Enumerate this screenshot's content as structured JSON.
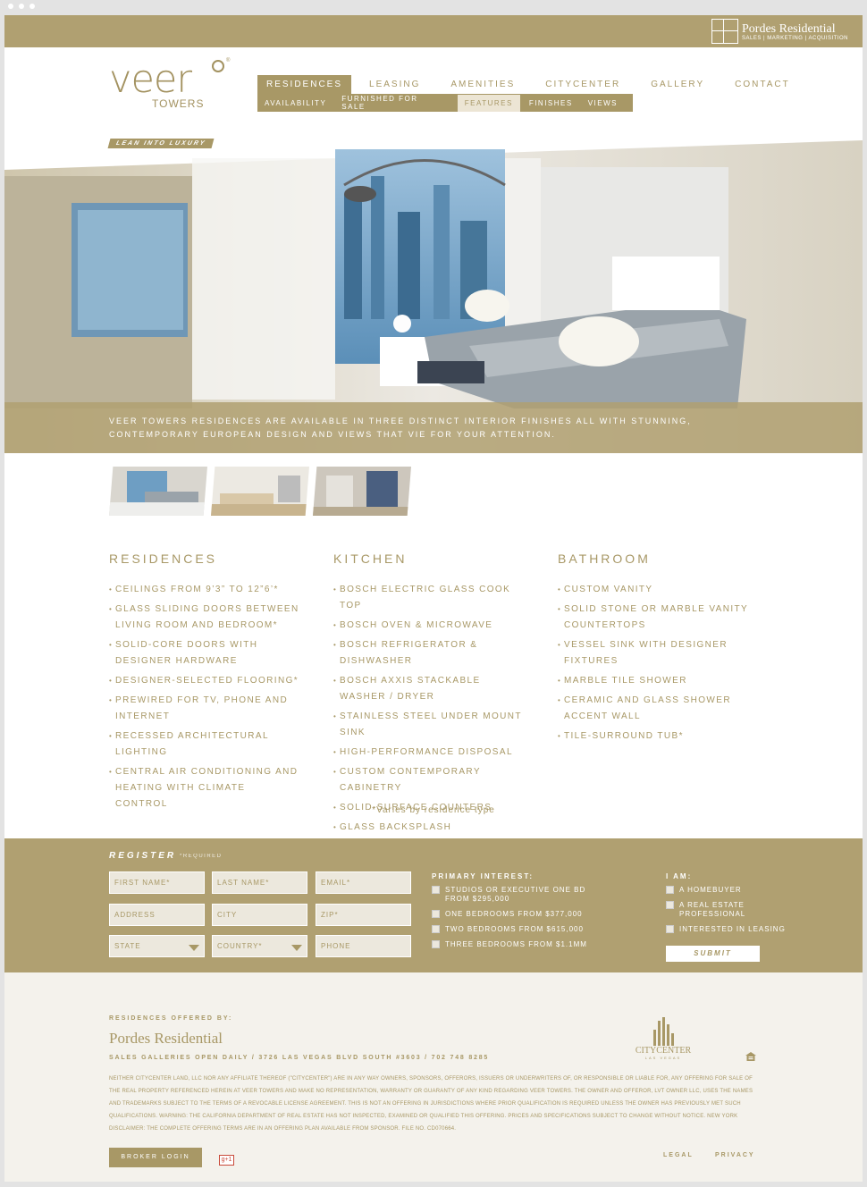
{
  "header": {
    "brand_name": "Pordes Residential",
    "brand_sub": "SALES | MARKETING | ACQUISITION"
  },
  "logo": {
    "word": "veer",
    "sub": "TOWERS"
  },
  "nav": {
    "items": [
      "RESIDENCES",
      "LEASING",
      "AMENITIES",
      "CITYCENTER",
      "GALLERY",
      "CONTACT"
    ],
    "subitems": [
      "AVAILABILITY",
      "FURNISHED FOR SALE",
      "FEATURES",
      "FINISHES",
      "VIEWS"
    ]
  },
  "tagline": "LEAN INTO LUXURY",
  "hero": {
    "caption": "VEER TOWERS RESIDENCES ARE AVAILABLE IN THREE DISTINCT INTERIOR FINISHES ALL WITH STUNNING, CONTEMPORARY EUROPEAN DESIGN AND VIEWS THAT VIE FOR YOUR ATTENTION."
  },
  "features": [
    {
      "title": "RESIDENCES",
      "items": [
        "CEILINGS FROM 9’3” TO 12”6’*",
        "GLASS SLIDING DOORS BETWEEN LIVING ROOM AND BEDROOM*",
        "SOLID-CORE DOORS WITH DESIGNER HARDWARE",
        "DESIGNER-SELECTED FLOORING*",
        "PREWIRED FOR TV, PHONE AND INTERNET",
        "RECESSED ARCHITECTURAL LIGHTING",
        "CENTRAL AIR CONDITIONING AND HEATING WITH CLIMATE CONTROL"
      ]
    },
    {
      "title": "KITCHEN",
      "items": [
        "BOSCH ELECTRIC GLASS COOK TOP",
        "BOSCH OVEN & MICROWAVE",
        "BOSCH REFRIGERATOR & DISHWASHER",
        "BOSCH AXXIS STACKABLE WASHER / DRYER",
        "STAINLESS STEEL UNDER MOUNT SINK",
        "HIGH-PERFORMANCE DISPOSAL",
        "CUSTOM CONTEMPORARY CABINETRY",
        "SOLID-SURFACE COUNTERS",
        "GLASS BACKSPLASH"
      ]
    },
    {
      "title": "BATHROOM",
      "items": [
        "CUSTOM VANITY",
        "SOLID STONE OR MARBLE VANITY COUNTERTOPS",
        "VESSEL SINK WITH DESIGNER FIXTURES",
        "MARBLE TILE SHOWER",
        "CERAMIC AND GLASS SHOWER ACCENT WALL",
        "TILE-SURROUND TUB*"
      ]
    }
  ],
  "footnote": "*Varies by residence type",
  "register": {
    "title": "REGISTER",
    "required": "*REQUIRED",
    "fields": {
      "first_name": "FIRST NAME*",
      "last_name": "LAST NAME*",
      "email": "EMAIL*",
      "address": "ADDRESS",
      "city": "CITY",
      "zip": "ZIP*",
      "state": "STATE",
      "country": "COUNTRY*",
      "phone": "PHONE"
    },
    "interest_title": "PRIMARY INTEREST:",
    "interest_options": [
      "STUDIOS OR EXECUTIVE ONE BD FROM $295,000",
      "ONE BEDROOMS FROM $377,000",
      "TWO BEDROOMS FROM $615,000",
      "THREE BEDROOMS FROM $1.1MM"
    ],
    "iam_title": "I AM:",
    "iam_options": [
      "A HOMEBUYER",
      "A REAL ESTATE PROFESSIONAL",
      "INTERESTED IN LEASING"
    ],
    "submit": "SUBMIT"
  },
  "footer": {
    "offered_by": "RESIDENCES OFFERED BY:",
    "pordes": "Pordes Residential",
    "galleries": "SALES GALLERIES OPEN DAILY / 3726 LAS VEGAS BLVD SOUTH #3603 / 702 748 8285",
    "citycenter": "CITYCENTER",
    "citycenter_sub": "LAS VEGAS",
    "disclaimer": "NEITHER CITYCENTER LAND, LLC NOR ANY AFFILIATE THEREOF (\"CITYCENTER\") ARE IN ANY WAY OWNERS, SPONSORS, OFFERORS, ISSUERS OR UNDERWRITERS OF, OR RESPONSIBLE OR LIABLE FOR, ANY OFFERING FOR SALE OF THE REAL PROPERTY REFERENCED HEREIN AT VEER TOWERS AND MAKE NO REPRESENTATION, WARRANTY OR GUARANTY OF ANY KIND REGARDING VEER TOWERS. THE OWNER AND OFFEROR, LVT OWNER LLC, USES THE NAMES AND TRADEMARKS SUBJECT TO THE TERMS OF A REVOCABLE LICENSE AGREEMENT. THIS IS NOT AN OFFERING IN JURISDICTIONS WHERE PRIOR QUALIFICATION IS REQUIRED UNLESS THE OWNER HAS PREVIOUSLY MET SUCH QUALIFICATIONS. WARNING: THE CALIFORNIA DEPARTMENT OF REAL ESTATE HAS NOT INSPECTED, EXAMINED OR QUALIFIED THIS OFFERING. PRICES AND SPECIFICATIONS SUBJECT TO CHANGE WITHOUT NOTICE. NEW YORK DISCLAIMER: THE COMPLETE OFFERING TERMS ARE IN AN OFFERING PLAN AVAILABLE FROM SPONSOR. FILE NO. CD070664.",
    "broker_login": "BROKER LOGIN",
    "gplus": "g+1",
    "legal": "LEGAL",
    "privacy": "PRIVACY"
  }
}
